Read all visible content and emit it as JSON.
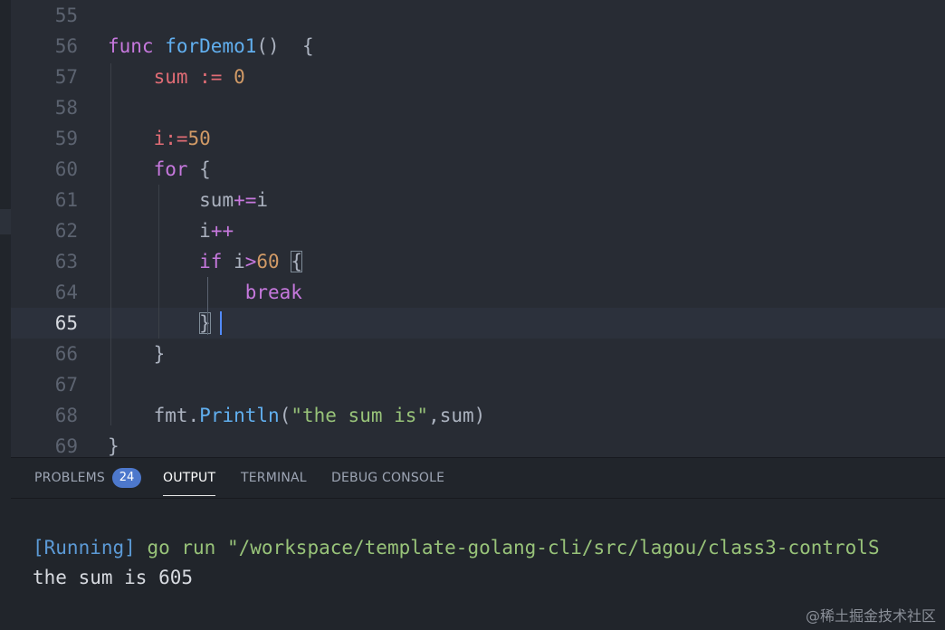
{
  "editor": {
    "lines": [
      {
        "number": "55"
      },
      {
        "number": "56",
        "tokens": [
          {
            "t": "func",
            "c": "kw"
          },
          {
            "t": " ",
            "c": "plain"
          },
          {
            "t": "forDemo1",
            "c": "fn"
          },
          {
            "t": "()  {",
            "c": "plain"
          }
        ]
      },
      {
        "number": "57",
        "tokens": [
          {
            "t": "    ",
            "c": "plain"
          },
          {
            "t": "sum",
            "c": "var"
          },
          {
            "t": " := ",
            "c": "var"
          },
          {
            "t": "0",
            "c": "num"
          }
        ]
      },
      {
        "number": "58"
      },
      {
        "number": "59",
        "tokens": [
          {
            "t": "    ",
            "c": "plain"
          },
          {
            "t": "i",
            "c": "var"
          },
          {
            "t": ":=",
            "c": "var"
          },
          {
            "t": "50",
            "c": "num"
          }
        ]
      },
      {
        "number": "60",
        "tokens": [
          {
            "t": "    ",
            "c": "plain"
          },
          {
            "t": "for",
            "c": "kw"
          },
          {
            "t": " {",
            "c": "plain"
          }
        ]
      },
      {
        "number": "61",
        "tokens": [
          {
            "t": "        ",
            "c": "plain"
          },
          {
            "t": "sum",
            "c": "plain"
          },
          {
            "t": "+=",
            "c": "kw"
          },
          {
            "t": "i",
            "c": "plain"
          }
        ]
      },
      {
        "number": "62",
        "tokens": [
          {
            "t": "        ",
            "c": "plain"
          },
          {
            "t": "i",
            "c": "plain"
          },
          {
            "t": "++",
            "c": "kw"
          }
        ]
      },
      {
        "number": "63",
        "tokens": [
          {
            "t": "        ",
            "c": "plain"
          },
          {
            "t": "if",
            "c": "kw"
          },
          {
            "t": " i",
            "c": "plain"
          },
          {
            "t": ">",
            "c": "kw"
          },
          {
            "t": "60",
            "c": "num"
          },
          {
            "t": " ",
            "c": "plain"
          },
          {
            "t": "{",
            "c": "plain",
            "box": true
          }
        ]
      },
      {
        "number": "64",
        "tokens": [
          {
            "t": "            ",
            "c": "plain"
          },
          {
            "t": "break",
            "c": "kw"
          }
        ]
      },
      {
        "number": "65",
        "current": true,
        "tokens": [
          {
            "t": "        ",
            "c": "plain"
          },
          {
            "t": "}",
            "c": "plain",
            "box": true
          }
        ]
      },
      {
        "number": "66",
        "tokens": [
          {
            "t": "    ",
            "c": "plain"
          },
          {
            "t": "}",
            "c": "plain"
          }
        ]
      },
      {
        "number": "67"
      },
      {
        "number": "68",
        "tokens": [
          {
            "t": "    ",
            "c": "plain"
          },
          {
            "t": "fmt",
            "c": "plain"
          },
          {
            "t": ".",
            "c": "plain"
          },
          {
            "t": "Println",
            "c": "fn"
          },
          {
            "t": "(",
            "c": "plain"
          },
          {
            "t": "\"the sum is\"",
            "c": "str"
          },
          {
            "t": ",sum)",
            "c": "plain"
          }
        ]
      },
      {
        "number": "69",
        "tokens": [
          {
            "t": "}",
            "c": "plain"
          }
        ]
      }
    ]
  },
  "panel": {
    "tabs": {
      "problems": "PROBLEMS",
      "problems_count": "24",
      "output": "OUTPUT",
      "terminal": "TERMINAL",
      "debug_console": "DEBUG CONSOLE"
    },
    "active_tab": "OUTPUT",
    "output": {
      "running_tag": "[Running]",
      "command": " go run \"/workspace/template-golang-cli/src/lagou/class3-controlS",
      "result": "the sum is 605"
    }
  },
  "watermark": "@稀土掘金技术社区",
  "colors": {
    "background": "#282c34",
    "panel_background": "#21252b",
    "keyword": "#c678dd",
    "function": "#61afef",
    "variable": "#e06c75",
    "number": "#d19a66",
    "string": "#98c379",
    "badge": "#4d78cc"
  }
}
